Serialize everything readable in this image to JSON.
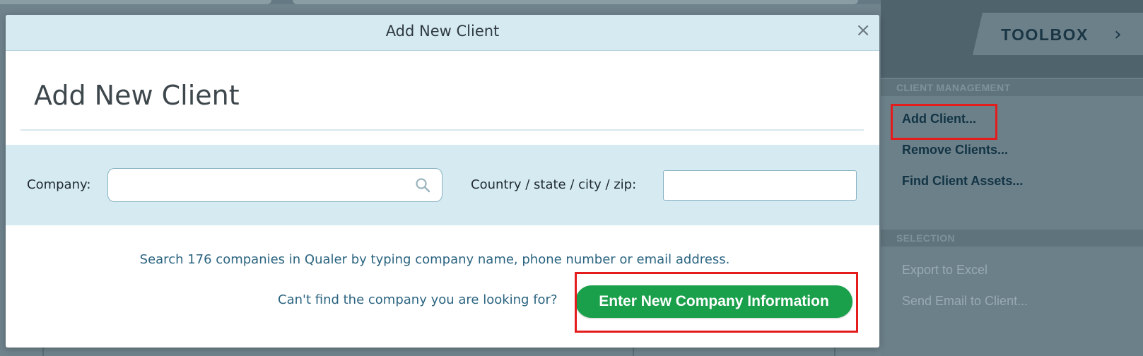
{
  "modal": {
    "title": "Add New Client",
    "close_glyph": "×",
    "heading": "Add New Client",
    "company_label": "Company:",
    "company_value": "",
    "location_label": "Country / state / city / zip:",
    "location_value": "",
    "hint": "Search 176 companies in Qualer by typing company name, phone number or email address.",
    "cant_find": "Can't find the company you are looking for?",
    "enter_button_label": "Enter New Company Information"
  },
  "toolbox": {
    "title": "TOOLBOX",
    "chevron_glyph": "›",
    "sections": [
      {
        "title": "CLIENT MANAGEMENT",
        "items": [
          "Add Client...",
          "Remove Clients...",
          "Find Client Assets..."
        ]
      },
      {
        "title": "SELECTION",
        "items": [
          "Export to Excel",
          "Send Email to Client..."
        ]
      }
    ]
  },
  "colors": {
    "accent_green": "#1aa04b",
    "highlight_red": "#e41c1c",
    "modal_band": "#d6eaf1",
    "link_blue": "#2b6480"
  },
  "icons": {
    "search": "search-icon",
    "close": "close-icon",
    "chevron": "chevron-right-icon"
  }
}
